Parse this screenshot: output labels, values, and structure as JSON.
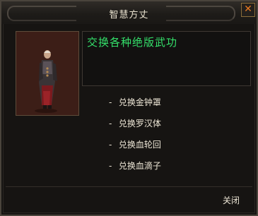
{
  "dialog": {
    "title": "智慧方丈",
    "close_icon_glyph": "✕",
    "description": "交换各种绝版武功",
    "options": [
      "兑换金钟罩",
      "兑换罗汉体",
      "兑换血轮回",
      "兑换血滴子"
    ],
    "option_prefix": "-",
    "close_label": "关闭",
    "colors": {
      "title_text": "#e9e2cf",
      "description_text": "#34e06a",
      "option_text": "#ede6d6",
      "close_icon": "#e87a22",
      "portrait_bg": "#3c1e17"
    }
  }
}
